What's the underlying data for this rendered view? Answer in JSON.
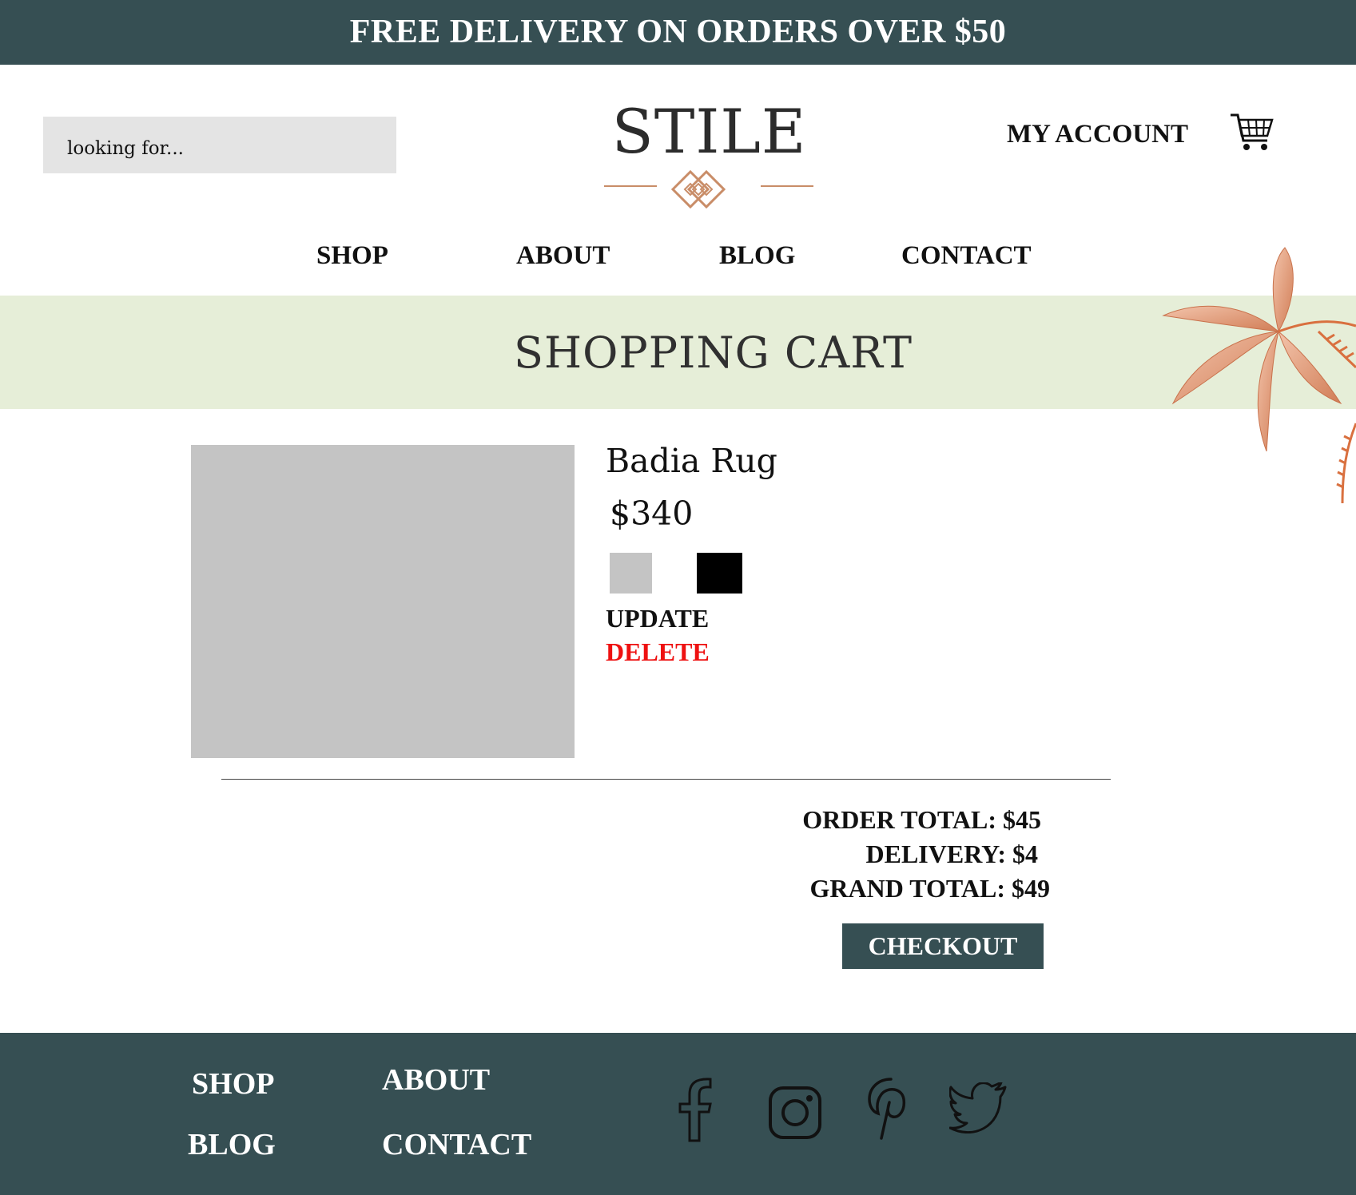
{
  "promo": {
    "text": "FREE DELIVERY ON ORDERS OVER $50"
  },
  "header": {
    "search_placeholder": "looking for...",
    "logo_text": "STILE",
    "account_label": "MY ACCOUNT"
  },
  "nav": {
    "shop": "SHOP",
    "about": "ABOUT",
    "blog": "BLOG",
    "contact": "CONTACT"
  },
  "page": {
    "title": "SHOPPING CART"
  },
  "cart": {
    "item": {
      "name": "Badia Rug",
      "price": "$340",
      "swatch_colors": [
        "#c4c4c4",
        "#000000"
      ],
      "update_label": "UPDATE",
      "delete_label": "DELETE"
    },
    "totals": {
      "order_total": "ORDER TOTAL: $45",
      "delivery": "DELIVERY: $4",
      "grand_total": "GRAND TOTAL: $49"
    },
    "checkout_label": "CHECKOUT"
  },
  "footer": {
    "shop": "SHOP",
    "about": "ABOUT",
    "blog": "BLOG",
    "contact": "CONTACT",
    "social_icons": [
      "facebook-icon",
      "instagram-icon",
      "pinterest-icon",
      "twitter-icon"
    ]
  },
  "colors": {
    "brand_dark": "#364f53",
    "banner_bg": "#e6eed8",
    "accent_copper": "#c98d68",
    "delete_red": "#ee1111"
  }
}
